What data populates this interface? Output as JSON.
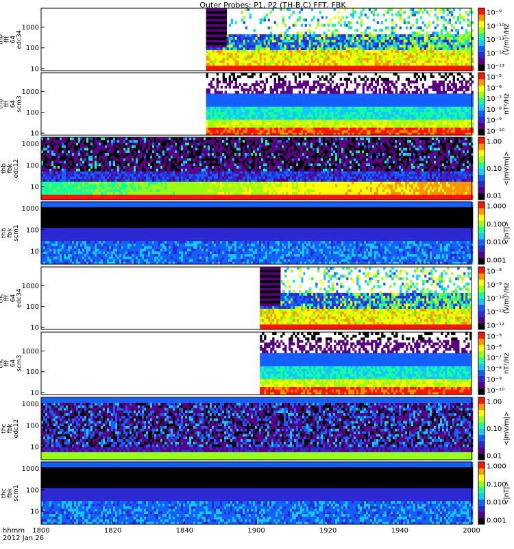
{
  "title": "Outer Probes: P1, P2 (TH-B,C) FFT, FBK",
  "colors": {
    "background": "#ffffff",
    "frame": "#000000",
    "empty": "#ffffff"
  },
  "chart_data": {
    "type": "heatmap",
    "x": {
      "label_top": "hhmm",
      "label_bottom": "2012 Jan 26",
      "ticks": [
        "1800",
        "1820",
        "1840",
        "1900",
        "1920",
        "1940",
        "2000"
      ],
      "tick_values_minutes": [
        0,
        20,
        40,
        60,
        80,
        100,
        120
      ],
      "range_minutes": [
        0,
        120
      ]
    },
    "colormap": [
      "#000000",
      "#5a0082",
      "#2c28d2",
      "#1460ff",
      "#14c8ff",
      "#14ff96",
      "#96ff14",
      "#ffff00",
      "#ff9600",
      "#ff1400"
    ],
    "panels": [
      {
        "name": "thb-fff64-edc34",
        "ylabel": [
          "thb",
          "fff",
          "64",
          "edc34"
        ],
        "yscale": "log",
        "ylim": [
          8,
          8000
        ],
        "yticks": [
          "10",
          "100",
          "1000"
        ],
        "ytick_values": [
          10,
          100,
          1000
        ],
        "colorbar_ticks": [
          "10⁻⁹",
          "10⁻¹⁰",
          "10⁻¹¹",
          "10⁻¹²",
          "10⁻¹³"
        ],
        "colorbar_unit": "(V/m)²/Hz",
        "data_start_minutes": 46,
        "style": "bursty"
      },
      {
        "name": "thb-fff64-scm3",
        "ylabel": [
          "thb",
          "fff",
          "64",
          "scm3"
        ],
        "yscale": "log",
        "ylim": [
          8,
          8000
        ],
        "yticks": [
          "10",
          "100",
          "1000"
        ],
        "ytick_values": [
          10,
          100,
          1000
        ],
        "colorbar_ticks": [
          "10⁻⁵",
          "10⁻⁶",
          "10⁻⁷",
          "10⁻⁸",
          "10⁻⁹",
          "10⁻¹⁰"
        ],
        "colorbar_unit": "nT²/Hz",
        "data_start_minutes": 46,
        "style": "banded"
      },
      {
        "name": "thb-fbk-edc12",
        "ylabel": [
          "thb",
          "fbk",
          "edc12"
        ],
        "yscale": "log",
        "ylim": [
          2.5,
          2000
        ],
        "yticks": [
          "10",
          "100",
          "1000"
        ],
        "ytick_values": [
          10,
          100,
          1000
        ],
        "colorbar_ticks": [
          "1.00",
          "0.10",
          "0.01"
        ],
        "colorbar_unit": "<|mV/m|>",
        "data_start_minutes": 0,
        "style": "fbk-e"
      },
      {
        "name": "thb-fbk-scm1",
        "ylabel": [
          "thb",
          "fbk",
          "scm1"
        ],
        "yscale": "log",
        "ylim": [
          2.5,
          2000
        ],
        "yticks": [
          "10",
          "100",
          "1000"
        ],
        "ytick_values": [
          10,
          100,
          1000
        ],
        "colorbar_ticks": [
          "1.000",
          "0.100",
          "0.010",
          "0.001"
        ],
        "colorbar_unit": "<|nT|>",
        "data_start_minutes": 0,
        "style": "fbk-b"
      },
      {
        "name": "thc-fff64-edc34",
        "ylabel": [
          "thc",
          "fff",
          "64",
          "edc34"
        ],
        "yscale": "log",
        "ylim": [
          8,
          8000
        ],
        "yticks": [
          "10",
          "100",
          "1000"
        ],
        "ytick_values": [
          10,
          100,
          1000
        ],
        "colorbar_ticks": [
          "10⁻⁸",
          "10⁻⁹",
          "10⁻¹⁰",
          "10⁻¹¹",
          "10⁻¹²"
        ],
        "colorbar_unit": "(V/m)²/Hz",
        "data_start_minutes": 61,
        "style": "bursty"
      },
      {
        "name": "thc-fff64-scm3",
        "ylabel": [
          "thc",
          "fff",
          "64",
          "scm3"
        ],
        "yscale": "log",
        "ylim": [
          8,
          8000
        ],
        "yticks": [
          "10",
          "100",
          "1000"
        ],
        "ytick_values": [
          10,
          100,
          1000
        ],
        "colorbar_ticks": [
          "10⁻⁵",
          "10⁻⁶",
          "10⁻⁷",
          "10⁻⁸",
          "10⁻⁹",
          "10⁻¹⁰"
        ],
        "colorbar_unit": "nT²/Hz",
        "data_start_minutes": 61,
        "style": "banded"
      },
      {
        "name": "thc-fbk-edc12",
        "ylabel": [
          "thc",
          "fbk",
          "edc12"
        ],
        "yscale": "log",
        "ylim": [
          2.5,
          2000
        ],
        "yticks": [
          "10",
          "100",
          "1000"
        ],
        "ytick_values": [
          10,
          100,
          1000
        ],
        "colorbar_ticks": [
          "1.00",
          "0.10",
          "0.01"
        ],
        "colorbar_unit": "<|mV/m|>",
        "data_start_minutes": 0,
        "style": "fbk-e2"
      },
      {
        "name": "thc-fbk-scm1",
        "ylabel": [
          "thc",
          "fbk",
          "scm1"
        ],
        "yscale": "log",
        "ylim": [
          2.5,
          2000
        ],
        "yticks": [
          "10",
          "100",
          "1000"
        ],
        "ytick_values": [
          10,
          100,
          1000
        ],
        "colorbar_ticks": [
          "1.000",
          "0.100",
          "0.010",
          "0.001"
        ],
        "colorbar_unit": "<|nT|>",
        "data_start_minutes": 0,
        "style": "fbk-b"
      }
    ]
  }
}
